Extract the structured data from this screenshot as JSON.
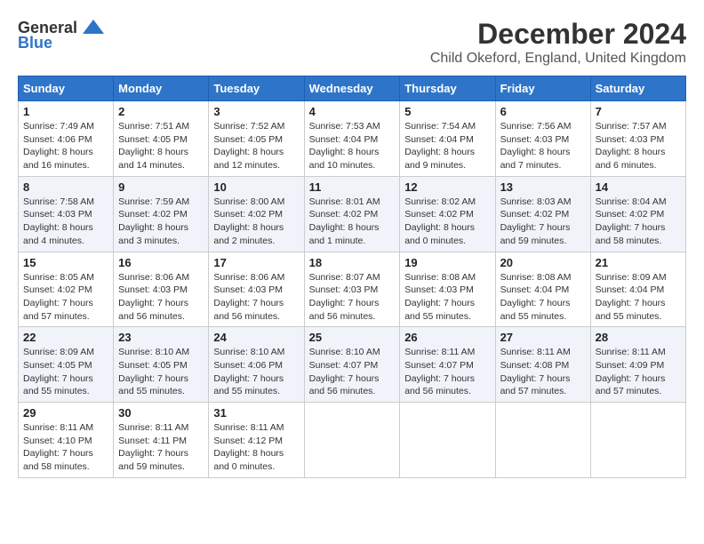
{
  "logo": {
    "general": "General",
    "blue": "Blue"
  },
  "title": "December 2024",
  "location": "Child Okeford, England, United Kingdom",
  "days_of_week": [
    "Sunday",
    "Monday",
    "Tuesday",
    "Wednesday",
    "Thursday",
    "Friday",
    "Saturday"
  ],
  "weeks": [
    [
      {
        "day": "1",
        "info": "Sunrise: 7:49 AM\nSunset: 4:06 PM\nDaylight: 8 hours and 16 minutes."
      },
      {
        "day": "2",
        "info": "Sunrise: 7:51 AM\nSunset: 4:05 PM\nDaylight: 8 hours and 14 minutes."
      },
      {
        "day": "3",
        "info": "Sunrise: 7:52 AM\nSunset: 4:05 PM\nDaylight: 8 hours and 12 minutes."
      },
      {
        "day": "4",
        "info": "Sunrise: 7:53 AM\nSunset: 4:04 PM\nDaylight: 8 hours and 10 minutes."
      },
      {
        "day": "5",
        "info": "Sunrise: 7:54 AM\nSunset: 4:04 PM\nDaylight: 8 hours and 9 minutes."
      },
      {
        "day": "6",
        "info": "Sunrise: 7:56 AM\nSunset: 4:03 PM\nDaylight: 8 hours and 7 minutes."
      },
      {
        "day": "7",
        "info": "Sunrise: 7:57 AM\nSunset: 4:03 PM\nDaylight: 8 hours and 6 minutes."
      }
    ],
    [
      {
        "day": "8",
        "info": "Sunrise: 7:58 AM\nSunset: 4:03 PM\nDaylight: 8 hours and 4 minutes."
      },
      {
        "day": "9",
        "info": "Sunrise: 7:59 AM\nSunset: 4:02 PM\nDaylight: 8 hours and 3 minutes."
      },
      {
        "day": "10",
        "info": "Sunrise: 8:00 AM\nSunset: 4:02 PM\nDaylight: 8 hours and 2 minutes."
      },
      {
        "day": "11",
        "info": "Sunrise: 8:01 AM\nSunset: 4:02 PM\nDaylight: 8 hours and 1 minute."
      },
      {
        "day": "12",
        "info": "Sunrise: 8:02 AM\nSunset: 4:02 PM\nDaylight: 8 hours and 0 minutes."
      },
      {
        "day": "13",
        "info": "Sunrise: 8:03 AM\nSunset: 4:02 PM\nDaylight: 7 hours and 59 minutes."
      },
      {
        "day": "14",
        "info": "Sunrise: 8:04 AM\nSunset: 4:02 PM\nDaylight: 7 hours and 58 minutes."
      }
    ],
    [
      {
        "day": "15",
        "info": "Sunrise: 8:05 AM\nSunset: 4:02 PM\nDaylight: 7 hours and 57 minutes."
      },
      {
        "day": "16",
        "info": "Sunrise: 8:06 AM\nSunset: 4:03 PM\nDaylight: 7 hours and 56 minutes."
      },
      {
        "day": "17",
        "info": "Sunrise: 8:06 AM\nSunset: 4:03 PM\nDaylight: 7 hours and 56 minutes."
      },
      {
        "day": "18",
        "info": "Sunrise: 8:07 AM\nSunset: 4:03 PM\nDaylight: 7 hours and 56 minutes."
      },
      {
        "day": "19",
        "info": "Sunrise: 8:08 AM\nSunset: 4:03 PM\nDaylight: 7 hours and 55 minutes."
      },
      {
        "day": "20",
        "info": "Sunrise: 8:08 AM\nSunset: 4:04 PM\nDaylight: 7 hours and 55 minutes."
      },
      {
        "day": "21",
        "info": "Sunrise: 8:09 AM\nSunset: 4:04 PM\nDaylight: 7 hours and 55 minutes."
      }
    ],
    [
      {
        "day": "22",
        "info": "Sunrise: 8:09 AM\nSunset: 4:05 PM\nDaylight: 7 hours and 55 minutes."
      },
      {
        "day": "23",
        "info": "Sunrise: 8:10 AM\nSunset: 4:05 PM\nDaylight: 7 hours and 55 minutes."
      },
      {
        "day": "24",
        "info": "Sunrise: 8:10 AM\nSunset: 4:06 PM\nDaylight: 7 hours and 55 minutes."
      },
      {
        "day": "25",
        "info": "Sunrise: 8:10 AM\nSunset: 4:07 PM\nDaylight: 7 hours and 56 minutes."
      },
      {
        "day": "26",
        "info": "Sunrise: 8:11 AM\nSunset: 4:07 PM\nDaylight: 7 hours and 56 minutes."
      },
      {
        "day": "27",
        "info": "Sunrise: 8:11 AM\nSunset: 4:08 PM\nDaylight: 7 hours and 57 minutes."
      },
      {
        "day": "28",
        "info": "Sunrise: 8:11 AM\nSunset: 4:09 PM\nDaylight: 7 hours and 57 minutes."
      }
    ],
    [
      {
        "day": "29",
        "info": "Sunrise: 8:11 AM\nSunset: 4:10 PM\nDaylight: 7 hours and 58 minutes."
      },
      {
        "day": "30",
        "info": "Sunrise: 8:11 AM\nSunset: 4:11 PM\nDaylight: 7 hours and 59 minutes."
      },
      {
        "day": "31",
        "info": "Sunrise: 8:11 AM\nSunset: 4:12 PM\nDaylight: 8 hours and 0 minutes."
      },
      {
        "day": "",
        "info": ""
      },
      {
        "day": "",
        "info": ""
      },
      {
        "day": "",
        "info": ""
      },
      {
        "day": "",
        "info": ""
      }
    ]
  ]
}
